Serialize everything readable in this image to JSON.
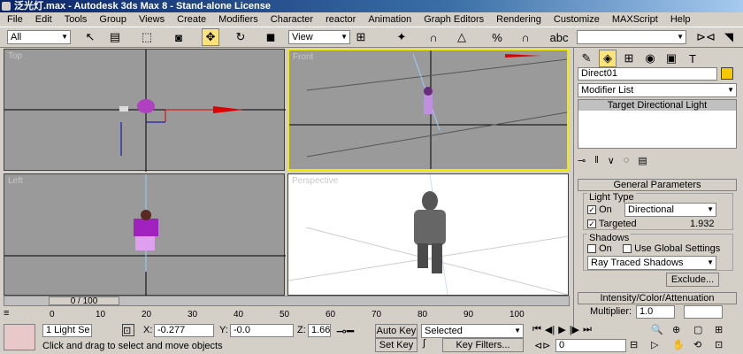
{
  "window": {
    "title": "泛光灯.max - Autodesk 3ds Max 8 - Stand-alone License"
  },
  "menu": [
    "File",
    "Edit",
    "Tools",
    "Group",
    "Views",
    "Create",
    "Modifiers",
    "Character",
    "reactor",
    "Animation",
    "Graph Editors",
    "Rendering",
    "Customize",
    "MAXScript",
    "Help"
  ],
  "toolbar": {
    "selection_filter": "All",
    "ref_coord": "View",
    "named_sel": ""
  },
  "viewports": {
    "top": "Top",
    "front": "Front",
    "left": "Left",
    "perspective": "Perspective"
  },
  "panel": {
    "object_name": "Direct01",
    "object_color": "#f5c800",
    "modifier_list": "Modifier List",
    "stack_item": "Target Directional Light",
    "general_params": "General Parameters",
    "light_type_label": "Light Type",
    "on_label": "On",
    "light_type_value": "Directional",
    "targeted_label": "Targeted",
    "targeted_value": "1.932",
    "shadows_label": "Shadows",
    "shadow_on_label": "On",
    "use_global_label": "Use Global Settings",
    "shadow_type": "Ray Traced Shadows",
    "exclude_label": "Exclude...",
    "intensity_rollout": "Intensity/Color/Attenuation",
    "multiplier_label": "Multiplier:",
    "multiplier_value": "1.0"
  },
  "timeline": {
    "slider": "0 / 100",
    "ticks": [
      "0",
      "10",
      "20",
      "30",
      "40",
      "50",
      "60",
      "70",
      "80",
      "90",
      "100"
    ]
  },
  "status": {
    "selection": "1 Light Se",
    "x_label": "X:",
    "x_value": "-0.277",
    "y_label": "Y:",
    "y_value": "-0.0",
    "z_label": "Z:",
    "z_value": "1.66",
    "prompt": "Click and drag to select and move objects",
    "auto_key": "Auto Key",
    "selected": "Selected",
    "set_key": "Set Key",
    "key_filters": "Key Filters...",
    "frame": "0"
  }
}
